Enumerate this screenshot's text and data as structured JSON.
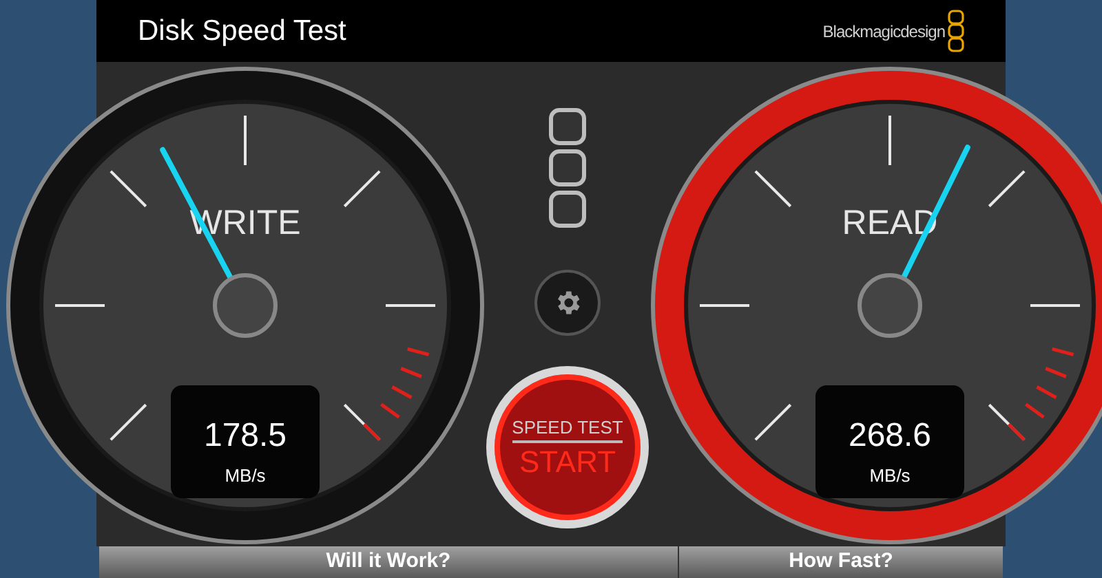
{
  "window": {
    "title": "Disk Speed Test",
    "brand": "Blackmagicdesign"
  },
  "gauges": [
    {
      "label": "WRITE",
      "reading": "178.5",
      "unit": "MB/s",
      "color": "#111111"
    },
    {
      "label": "READ",
      "reading": "268.6",
      "unit": "MB/s",
      "color": "#d41a12"
    }
  ],
  "start_button": {
    "caption": "SPEED TEST",
    "label": "START"
  },
  "tabs": [
    {
      "label": "Will it Work?"
    },
    {
      "label": "How Fast?"
    }
  ]
}
